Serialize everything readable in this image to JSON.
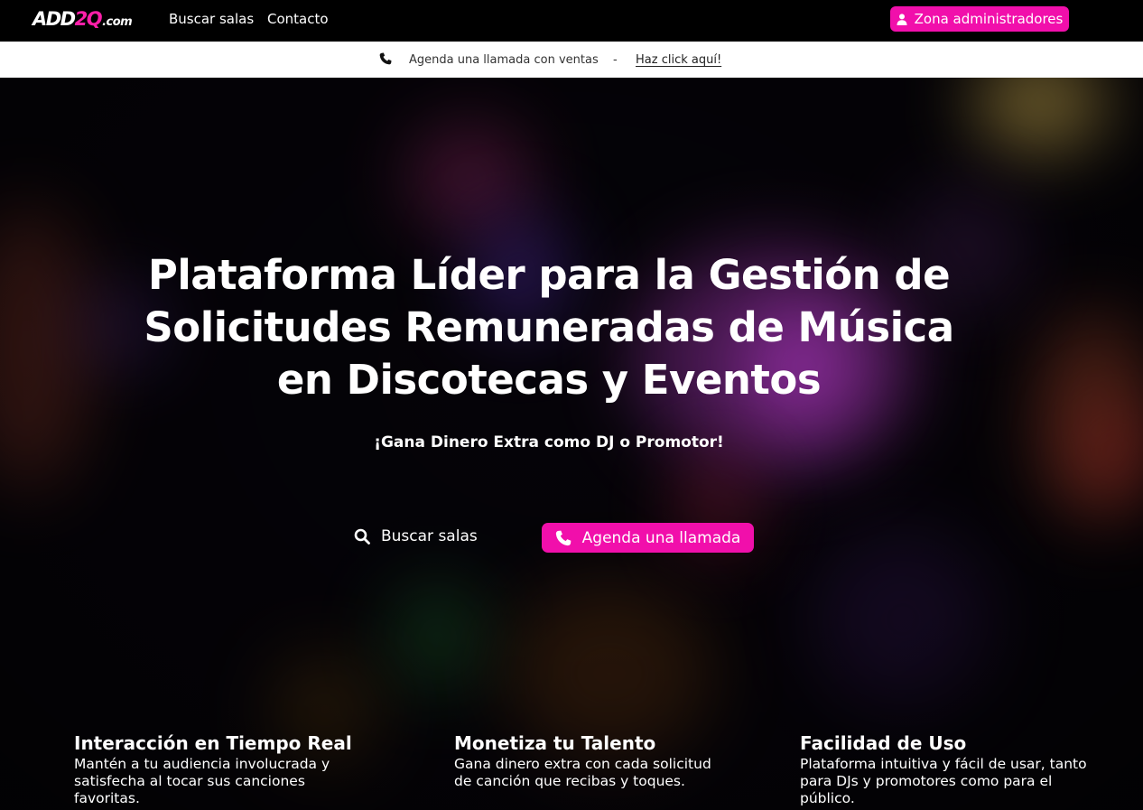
{
  "brand": {
    "logo_main": "ADD",
    "logo_two": "2Q",
    "logo_domain": ".com",
    "accent_color": "#f10fab"
  },
  "nav": {
    "links": [
      "Buscar salas",
      "Contacto"
    ],
    "admin_label": "Zona administradores",
    "admin_icon": "user-icon"
  },
  "infobar": {
    "icon": "phone-icon",
    "text": "Agenda una llamada con ventas",
    "separator": "-",
    "link": "Haz click aquí!"
  },
  "hero": {
    "title": "Plataforma Líder para la Gestión de Solicitudes Remuneradas de Música en Discotecas y Eventos",
    "subtitle": "¡Gana Dinero Extra como DJ o Promotor!",
    "search_label": "Buscar salas",
    "search_icon": "search-icon",
    "call_label": "Agenda una llamada",
    "call_icon": "phone-icon"
  },
  "features": [
    {
      "title": "Interacción en Tiempo Real",
      "text": "Mantén a tu audiencia involucrada y satisfecha al tocar sus canciones favoritas."
    },
    {
      "title": "Monetiza tu Talento",
      "text": "Gana dinero extra con cada solicitud de canción que recibas y toques."
    },
    {
      "title": "Facilidad de Uso",
      "text": "Plataforma intuitiva y fácil de usar, tanto para DJs y promotores como para el público."
    }
  ]
}
